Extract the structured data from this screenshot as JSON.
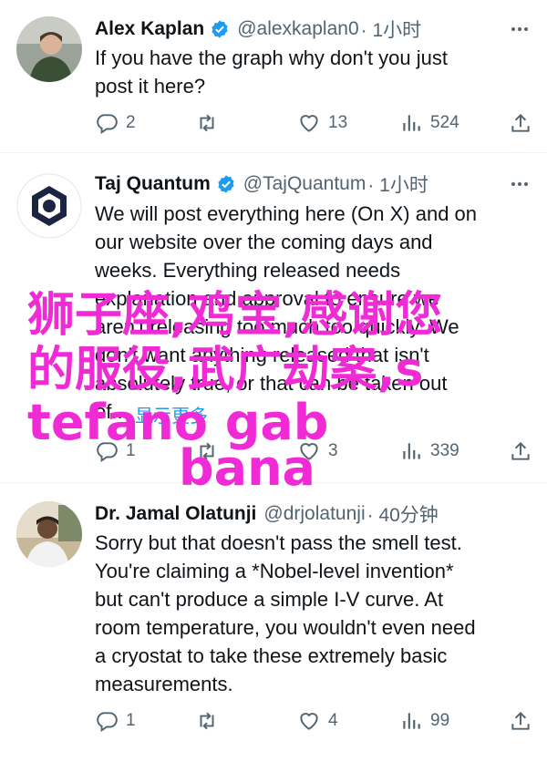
{
  "colors": {
    "verified_badge": "#1d9bf0",
    "secondary_text": "#536471",
    "link": "#1d9bf0",
    "overlay_text": "#f02bd6"
  },
  "tweets": [
    {
      "name": "Alex Kaplan",
      "handle": "@alexkaplan0",
      "time": "· 1小时",
      "text": [
        "If you have the graph why don't you just",
        "post it here?"
      ],
      "replies": "2",
      "retweets": "",
      "likes": "13",
      "views": "524"
    },
    {
      "name": "Taj Quantum",
      "handle": "@TajQuantum",
      "time": "· 1小时",
      "text": [
        "We will post everything here (On X) and on",
        "our website over the coming days and",
        "weeks. Everything released needs",
        "explanation and approval to ensure we",
        "aren't releasing too much too quickly. We",
        "don't want anything released that isn't",
        "absolutely true, or that can be taken out",
        "of..."
      ],
      "show_more": "显示更多",
      "replies": "1",
      "retweets": "",
      "likes": "3",
      "views": "339"
    },
    {
      "name": "Dr. Jamal Olatunji",
      "handle": "@drjolatunji",
      "time": "· 40分钟",
      "text": [
        "Sorry but that doesn't pass the smell test.",
        "You're claiming a *Nobel-level invention*",
        "but can't produce a simple I-V curve. At",
        "room temperature, you wouldn't even need",
        "a cryostat to take these extremely basic",
        "measurements."
      ],
      "replies": "1",
      "retweets": "",
      "likes": "4",
      "views": "99"
    }
  ],
  "overlay": {
    "line1": "狮子座,鸡宝,感谢您",
    "line2": "的服役,武广劫案,s",
    "line3": "tefano gab",
    "line4": "bana"
  },
  "icons": [
    "reply-icon",
    "retweet-icon",
    "like-icon",
    "views-icon",
    "share-icon",
    "more-icon",
    "verified-badge-icon"
  ]
}
